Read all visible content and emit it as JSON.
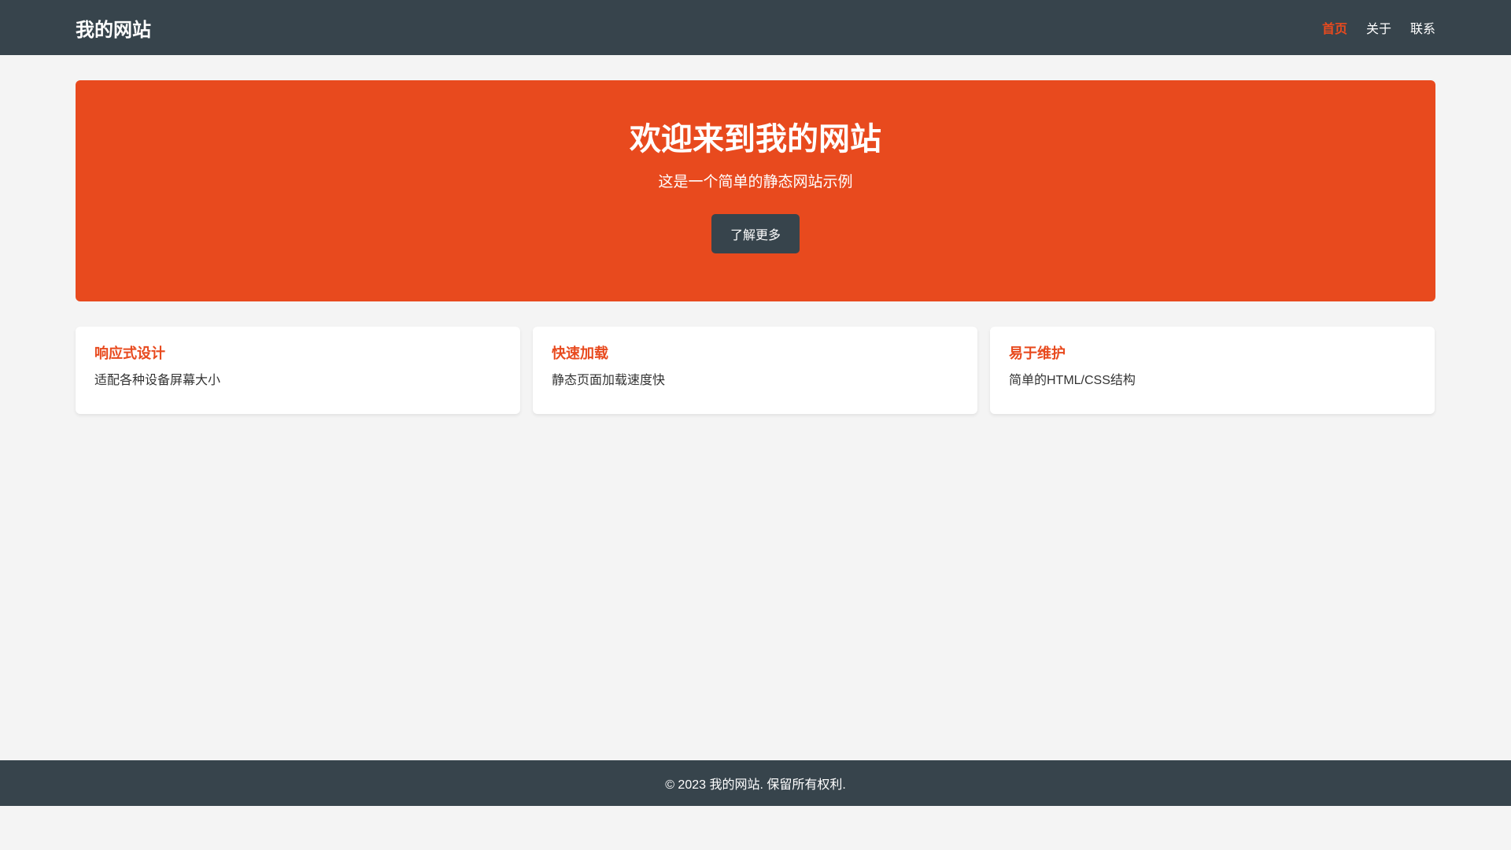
{
  "header": {
    "logo": "我的网站",
    "nav": [
      {
        "label": "首页",
        "active": true
      },
      {
        "label": "关于",
        "active": false
      },
      {
        "label": "联系",
        "active": false
      }
    ]
  },
  "hero": {
    "title": "欢迎来到我的网站",
    "subtitle": "这是一个简单的静态网站示例",
    "button_label": "了解更多"
  },
  "features": [
    {
      "title": "响应式设计",
      "text": "适配各种设备屏幕大小"
    },
    {
      "title": "快速加载",
      "text": "静态页面加载速度快"
    },
    {
      "title": "易于维护",
      "text": "简单的HTML/CSS结构"
    }
  ],
  "footer": {
    "text": "© 2023 我的网站. 保留所有权利."
  },
  "colors": {
    "accent": "#e84a1e",
    "header_bg": "#37444c",
    "page_bg": "#f4f4f4",
    "card_bg": "#ffffff"
  }
}
